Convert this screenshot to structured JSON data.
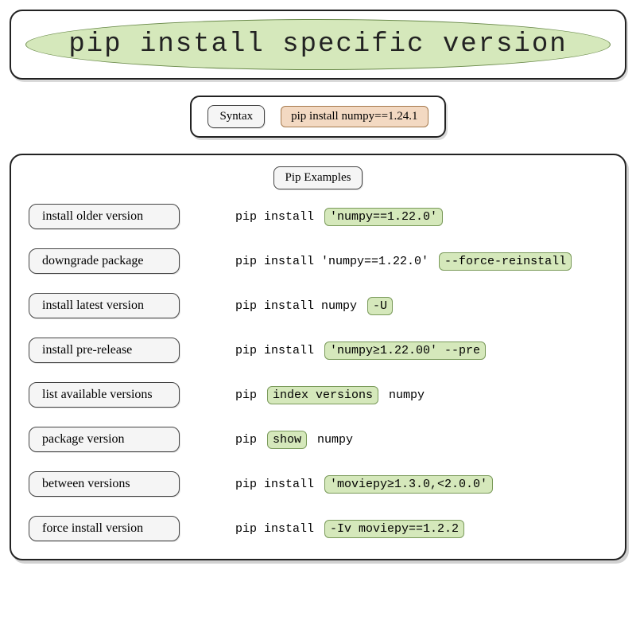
{
  "title": "pip install specific version",
  "syntax": {
    "label": "Syntax",
    "code": "pip install numpy==1.24.1"
  },
  "examples": {
    "header": "Pip Examples",
    "rows": [
      {
        "label": "install older version",
        "parts": [
          {
            "t": "plain",
            "text": "pip install "
          },
          {
            "t": "hl",
            "text": "'numpy==1.22.0'"
          }
        ]
      },
      {
        "label": "downgrade package",
        "parts": [
          {
            "t": "plain",
            "text": "pip install 'numpy==1.22.0' "
          },
          {
            "t": "hl",
            "text": "--force-reinstall"
          }
        ]
      },
      {
        "label": "install latest version",
        "parts": [
          {
            "t": "plain",
            "text": "pip install numpy "
          },
          {
            "t": "hl",
            "text": "-U"
          }
        ]
      },
      {
        "label": "install pre-release",
        "parts": [
          {
            "t": "plain",
            "text": "pip install "
          },
          {
            "t": "hl",
            "text": "'numpy≥1.22.00' --pre"
          }
        ]
      },
      {
        "label": "list available versions",
        "parts": [
          {
            "t": "plain",
            "text": "pip "
          },
          {
            "t": "hl",
            "text": "index versions"
          },
          {
            "t": "plain",
            "text": " numpy"
          }
        ]
      },
      {
        "label": "package version",
        "parts": [
          {
            "t": "plain",
            "text": "pip "
          },
          {
            "t": "hl",
            "text": "show"
          },
          {
            "t": "plain",
            "text": " numpy"
          }
        ]
      },
      {
        "label": "between versions",
        "parts": [
          {
            "t": "plain",
            "text": "pip install "
          },
          {
            "t": "hl",
            "text": "'moviepy≥1.3.0,<2.0.0'"
          }
        ]
      },
      {
        "label": "force install version",
        "parts": [
          {
            "t": "plain",
            "text": "pip install "
          },
          {
            "t": "hl",
            "text": "-Iv moviepy==1.2.2"
          }
        ]
      }
    ]
  }
}
